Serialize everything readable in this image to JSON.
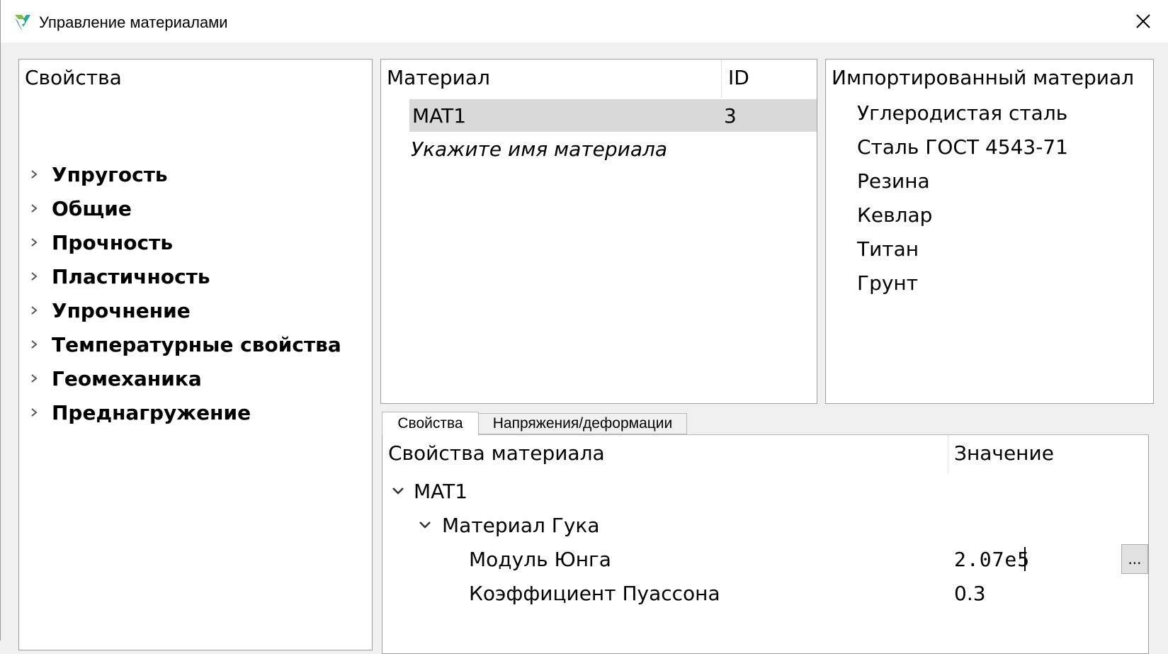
{
  "window": {
    "title": "Управление материалами"
  },
  "properties_panel": {
    "header": "Свойства",
    "items": [
      {
        "label": "Упругость"
      },
      {
        "label": "Общие"
      },
      {
        "label": "Прочность"
      },
      {
        "label": "Пластичность"
      },
      {
        "label": "Упрочнение"
      },
      {
        "label": "Температурные свойства"
      },
      {
        "label": "Геомеханика"
      },
      {
        "label": "Преднагружение"
      }
    ]
  },
  "materials_table": {
    "columns": [
      "Материал",
      "ID"
    ],
    "rows": [
      {
        "name": "MAT1",
        "id": "3"
      }
    ],
    "placeholder": "Укажите имя материала"
  },
  "imported_panel": {
    "header": "Импортированный материал",
    "items": [
      "Углеродистая сталь",
      "Сталь ГОСТ 4543-71",
      "Резина",
      "Кевлар",
      "Титан",
      "Грунт"
    ]
  },
  "tabs": [
    {
      "label": "Свойства",
      "active": true
    },
    {
      "label": "Напряжения/деформации",
      "active": false
    }
  ],
  "material_properties": {
    "columns": [
      "Свойства материала",
      "Значение"
    ],
    "root": "MAT1",
    "group": "Материал Гука",
    "rows": [
      {
        "label": "Модуль Юнга",
        "value": "2.07e5"
      },
      {
        "label": "Коэффициент Пуассона",
        "value": "0.3"
      }
    ],
    "edit_button_label": "..."
  },
  "colors": {
    "selected_row": "#d9d9d9",
    "panel_border": "#a0a0a0",
    "background": "#f0f0f0",
    "icon_teal": "#2aa89a",
    "icon_green": "#7cc242"
  }
}
